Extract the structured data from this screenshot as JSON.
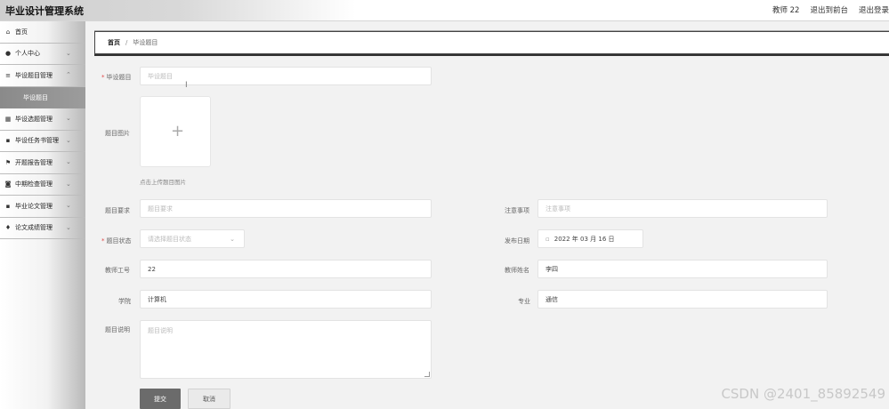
{
  "app": {
    "title": "毕业设计管理系统"
  },
  "header": {
    "user": "教师 22",
    "links": [
      "退出到前台",
      "退出登录"
    ]
  },
  "sidebar": {
    "items": [
      {
        "label": "首页",
        "icon": "home-icon",
        "glyph": "⌂"
      },
      {
        "label": "个人中心",
        "icon": "user-icon",
        "glyph": "●",
        "chevron": true
      },
      {
        "label": "毕设题目管理",
        "icon": "list-icon",
        "glyph": "≡",
        "chevron": true
      },
      {
        "label": "毕设题目",
        "sub": true
      },
      {
        "label": "毕设选题管理",
        "icon": "grid-icon",
        "glyph": "▦",
        "chevron": true
      },
      {
        "label": "毕设任务书管理",
        "icon": "apps-icon",
        "glyph": "▪",
        "chevron": true
      },
      {
        "label": "开题报告管理",
        "icon": "flag-icon",
        "glyph": "⚑",
        "chevron": true
      },
      {
        "label": "中期检查管理",
        "icon": "clipboard-icon",
        "glyph": "◙",
        "chevron": true
      },
      {
        "label": "毕业论文管理",
        "icon": "apps-icon",
        "glyph": "▪",
        "chevron": true
      },
      {
        "label": "论文成绩管理",
        "icon": "location-icon",
        "glyph": "♦",
        "chevron": true
      }
    ]
  },
  "breadcrumb": {
    "home": "首页",
    "separator": "/",
    "current": "毕设题目"
  },
  "form": {
    "topic": {
      "label": "毕设题目",
      "placeholder": "毕设题目",
      "required": true
    },
    "image": {
      "label": "题目图片",
      "hint": "点击上传题目图片"
    },
    "requirements": {
      "label": "题目要求",
      "placeholder": "题目要求"
    },
    "notes": {
      "label": "注意事项",
      "placeholder": "注意事项"
    },
    "status": {
      "label": "题目状态",
      "placeholder": "请选择题目状态",
      "required": true
    },
    "publish_date": {
      "label": "发布日期",
      "value": "2022 年 03 月 16 日"
    },
    "teacher_id": {
      "label": "教师工号",
      "value": "22"
    },
    "teacher_name": {
      "label": "教师姓名",
      "value": "李四"
    },
    "college": {
      "label": "学院",
      "value": "计算机"
    },
    "major": {
      "label": "专业",
      "value": "通信"
    },
    "description": {
      "label": "题目说明",
      "placeholder": "题目说明"
    },
    "submit_label": "提交",
    "cancel_label": "取消"
  },
  "watermark": "CSDN @2401_85892549",
  "colors": {
    "primary_button": "#6b6b6b",
    "required_mark": "#e04848"
  }
}
